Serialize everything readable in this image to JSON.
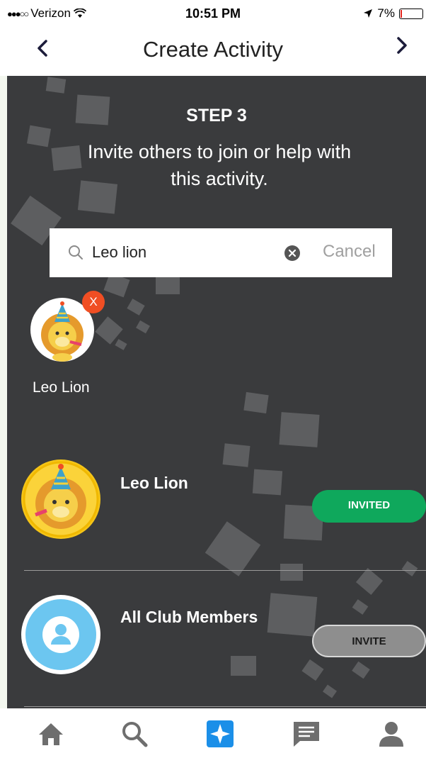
{
  "status_bar": {
    "carrier": "Verizon",
    "time": "10:51 PM",
    "battery": "7%",
    "battery_level": 0.07
  },
  "nav": {
    "title": "Create Activity"
  },
  "step": {
    "title": "STEP 3",
    "subtitle": "Invite others to join or help with this activity."
  },
  "search": {
    "value": "Leo lion",
    "cancel_label": "Cancel"
  },
  "selected": [
    {
      "name": "Leo Lion",
      "remove_label": "X"
    }
  ],
  "results": [
    {
      "name": "Leo Lion",
      "button_label": "INVITED",
      "status": "invited"
    },
    {
      "name": "All Club Members",
      "button_label": "INVITE",
      "status": "not-invited"
    }
  ],
  "tabs": [
    {
      "name": "home",
      "icon": "home-icon",
      "active": false
    },
    {
      "name": "search",
      "icon": "search-icon",
      "active": false
    },
    {
      "name": "create",
      "icon": "create-activity-icon",
      "active": true
    },
    {
      "name": "messages",
      "icon": "messages-icon",
      "active": false
    },
    {
      "name": "profile",
      "icon": "profile-icon",
      "active": false
    }
  ],
  "colors": {
    "background": "#3a3b3d",
    "invited": "#0fa85c",
    "invite": "#8e8e8e",
    "accent": "#1b8fe8",
    "remove_badge": "#f04e23"
  }
}
